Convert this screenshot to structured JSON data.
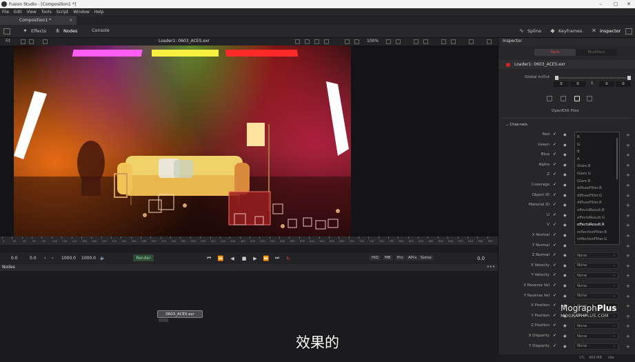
{
  "window": {
    "title": "Fusion Studio - [Composition1 *]",
    "controls": [
      "–",
      "▢",
      "✕"
    ]
  },
  "menu": [
    "File",
    "Edit",
    "View",
    "Tools",
    "Script",
    "Window",
    "Help"
  ],
  "tab": {
    "label": "Composition1 *",
    "close": "×"
  },
  "toolbar": {
    "effects": "Effects",
    "nodes": "Nodes",
    "console": "Console",
    "spline": "Spline",
    "keyframes": "Keyframes",
    "inspector": "Inspector"
  },
  "viewer": {
    "fit_label": "Fit",
    "file_info": "Loader1: 0603_ACES.exr",
    "zoom": "100%"
  },
  "timeline": {
    "ticks": [
      "0",
      "20",
      "40",
      "60",
      "80",
      "100",
      "120",
      "140",
      "160",
      "180",
      "200",
      "220",
      "240",
      "260",
      "280",
      "300",
      "320",
      "340",
      "360",
      "380",
      "400",
      "420",
      "440",
      "460",
      "480",
      "500",
      "520",
      "540",
      "560",
      "580",
      "600",
      "620",
      "640",
      "660",
      "680",
      "700",
      "720",
      "740",
      "760",
      "780",
      "800",
      "820",
      "840",
      "860",
      "880",
      "900",
      "920",
      "940",
      "960",
      "980"
    ]
  },
  "transport": {
    "start": "0.0",
    "current": "0.0",
    "end_a": "1000.0",
    "end_b": "1000.0",
    "render_label": "Render",
    "hiq": "HiQ",
    "mb": "MB",
    "prx": "Prx",
    "aprx": "APrx",
    "some": "Some",
    "frame": "0.0"
  },
  "nodes_panel": {
    "title": "Nodes",
    "node_label": "0603_ACES.exr"
  },
  "subtitle": "效果的",
  "inspector": {
    "title": "Inspector",
    "tabs": [
      "Tools",
      "Modifiers"
    ],
    "loader_name": "Loader1: 0603_ACES.exr",
    "global_inout_label": "Global In/Out",
    "inout_values": [
      "0",
      "0",
      "1",
      "0",
      "0"
    ],
    "openexr_label": "OpenEXR Files",
    "channels_label": "Channels",
    "channel_rows": [
      "Red",
      "Green",
      "Blue",
      "Alpha",
      "Z",
      "Coverage",
      "Object ID",
      "Material ID",
      "U",
      "V",
      "X Normal",
      "Y Normal",
      "Z Normal",
      "X Velocity",
      "Y Velocity",
      "X Reverse Vel",
      "Y Reverse Vel",
      "X Position",
      "Y Position",
      "Z Position",
      "X Disparity",
      "Y Disparity"
    ],
    "dropdown_options": [
      "R",
      "G",
      "B",
      "A",
      "Glare.B",
      "Glare.G",
      "Glare.R",
      "diffuseFilter.B",
      "diffuseFilter.G",
      "diffuseFilter.R",
      "effectsResult.B",
      "effectsResult.G",
      "effectsResult.R",
      "reflectionFilter.B",
      "reflectionFilter.G"
    ],
    "selected_option": "effectsResult.R",
    "none_label": "None"
  },
  "watermark": {
    "brand_a": "Mograph",
    "brand_b": "Plus",
    "url": "MOGRAPHPLUS.COM"
  },
  "status": {
    "percent": "1%",
    "memory": "469 MB",
    "state": "Idle"
  }
}
